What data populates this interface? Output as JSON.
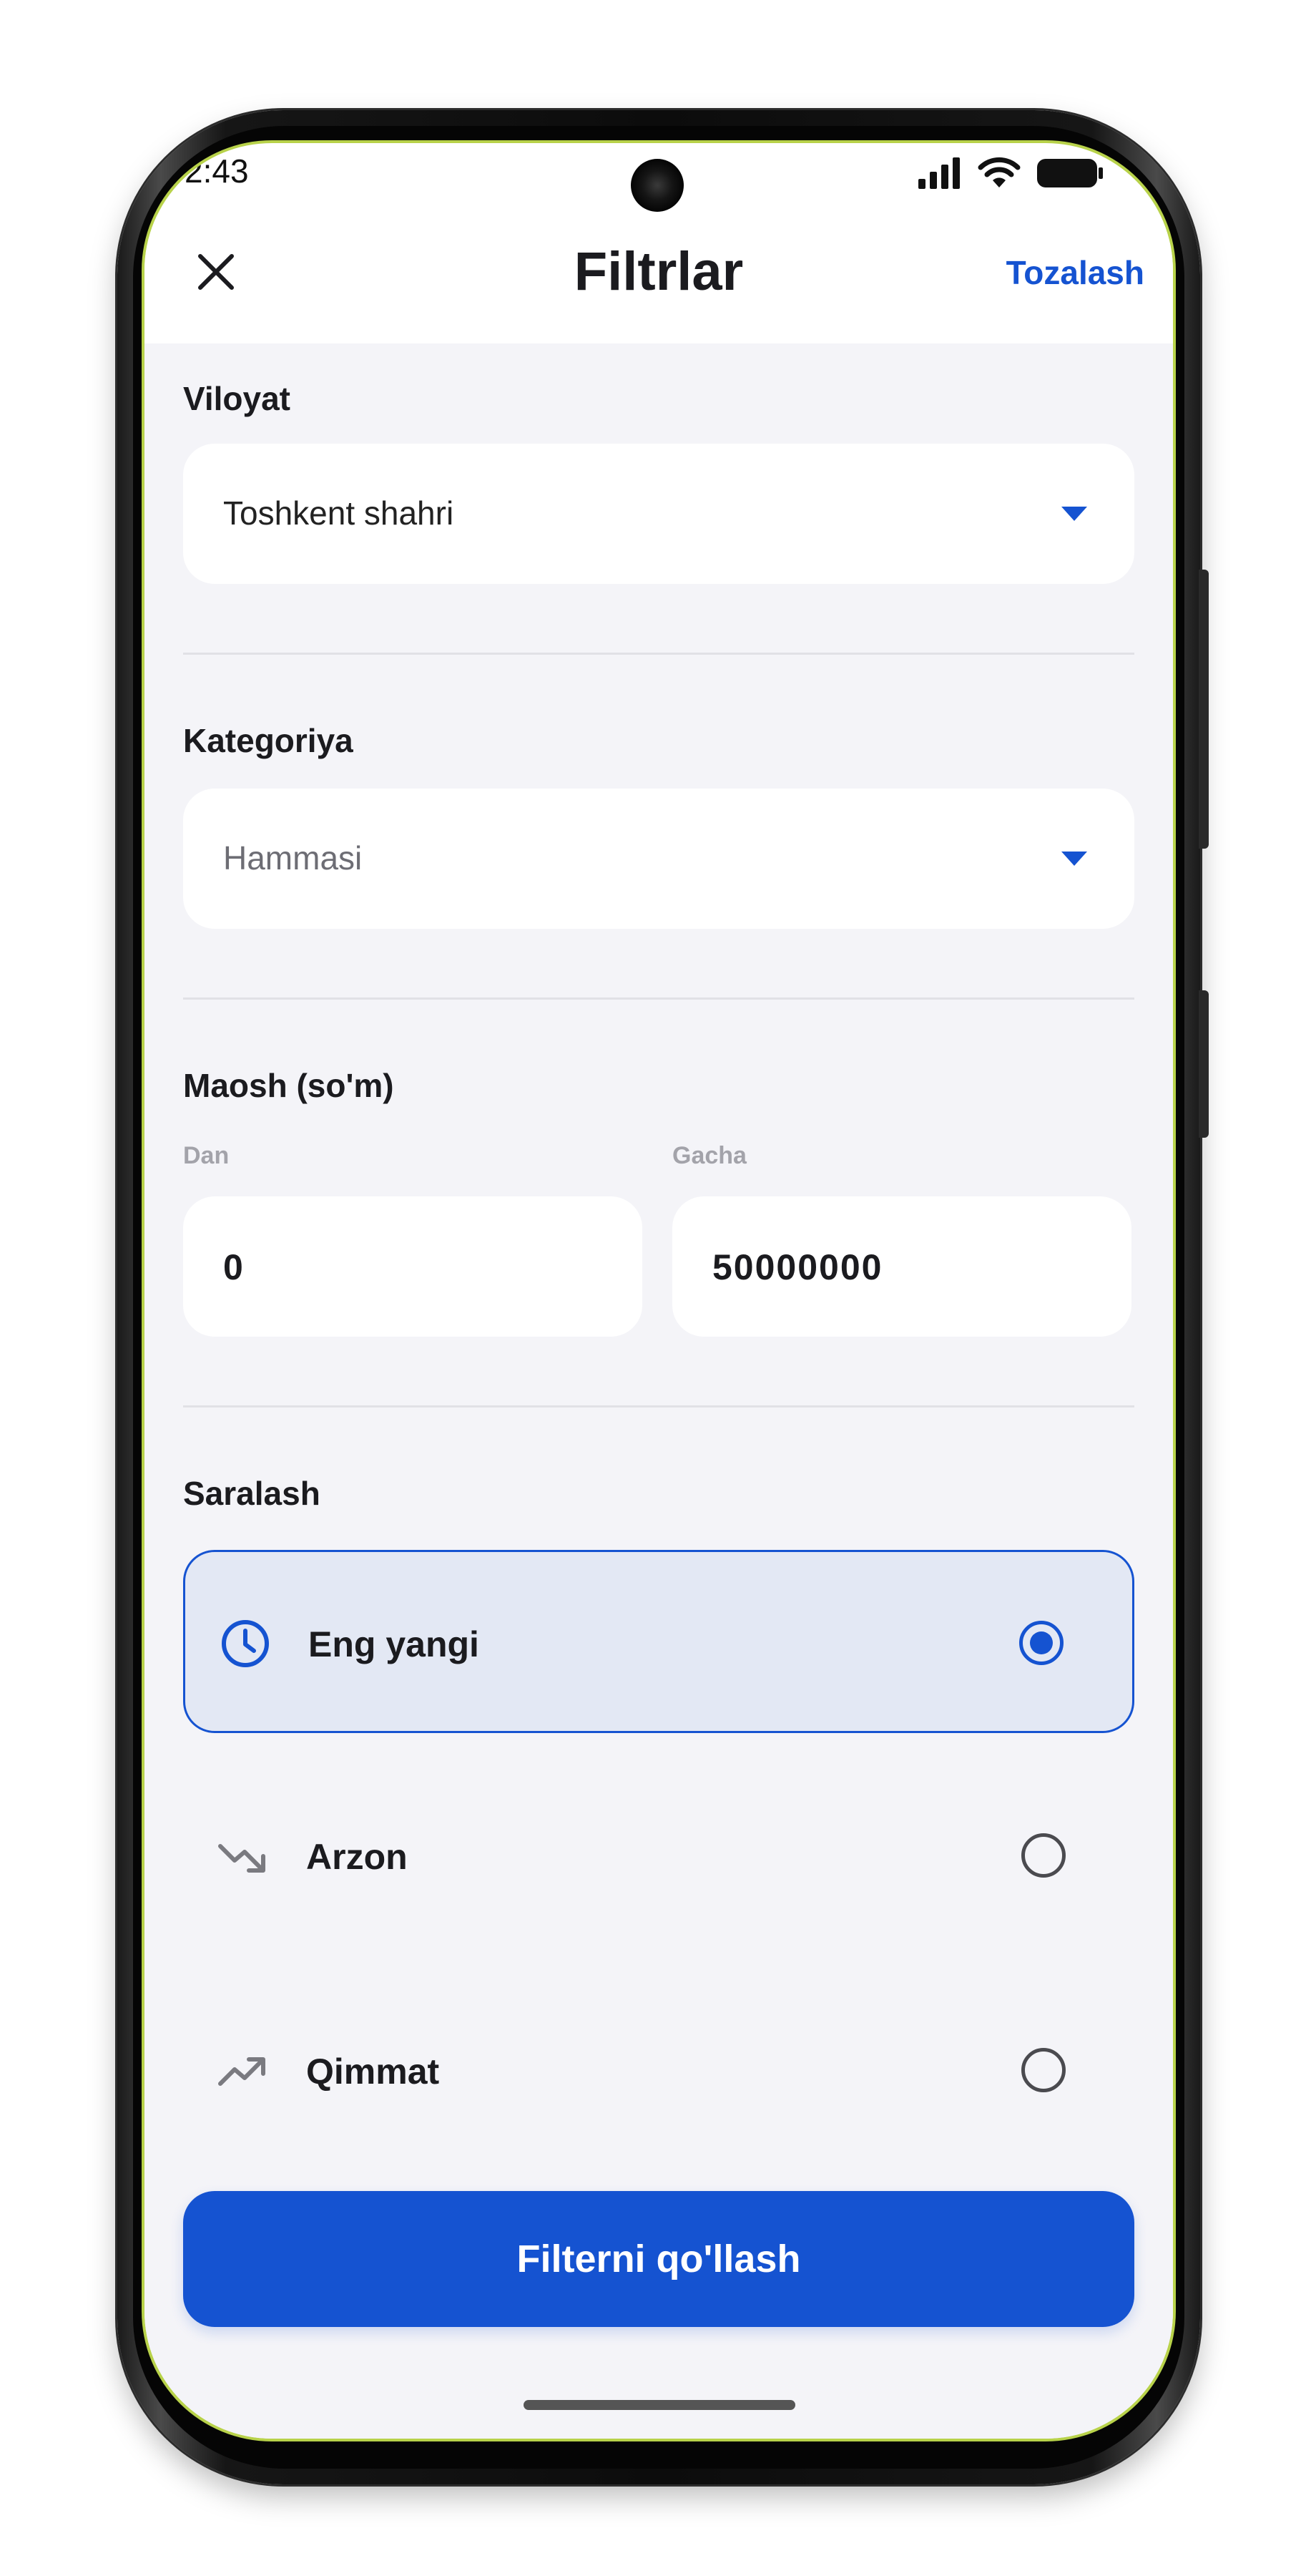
{
  "status_bar": {
    "time": "2:43"
  },
  "header": {
    "title": "Filtrlar",
    "clear_label": "Tozalash"
  },
  "region": {
    "label": "Viloyat",
    "value": "Toshkent shahri"
  },
  "category": {
    "label": "Kategoriya",
    "value": "Hammasi"
  },
  "salary": {
    "label": "Maosh (so'm)",
    "from_label": "Dan",
    "from_value": "0",
    "to_label": "Gacha",
    "to_value": "50000000"
  },
  "sort": {
    "label": "Saralash",
    "options": [
      {
        "label": "Eng yangi",
        "icon": "clock-icon",
        "selected": true
      },
      {
        "label": "Arzon",
        "icon": "trending-down-icon",
        "selected": false
      },
      {
        "label": "Qimmat",
        "icon": "trending-up-icon",
        "selected": false
      }
    ]
  },
  "apply_button": {
    "label": "Filterni qo'llash"
  },
  "colors": {
    "accent": "#1553d1",
    "background": "#f4f4f8",
    "selected_bg": "#e3e8f4"
  }
}
